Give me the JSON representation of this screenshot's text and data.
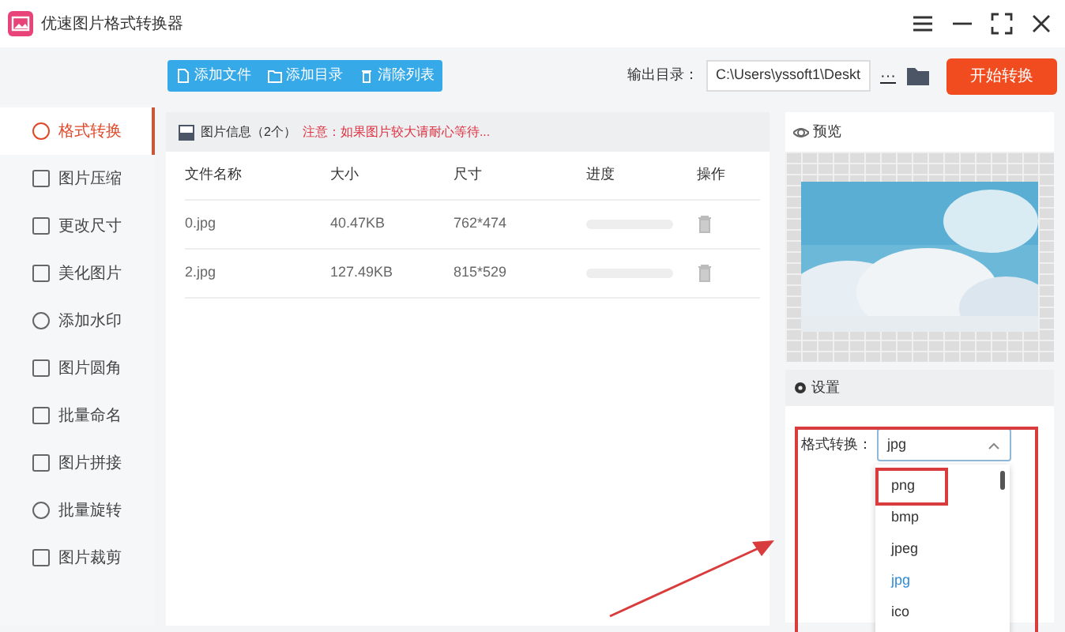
{
  "window": {
    "title": "优速图片格式转换器"
  },
  "toolbar": {
    "buttons": [
      {
        "label": "添加文件"
      },
      {
        "label": "添加目录"
      },
      {
        "label": "清除列表"
      }
    ],
    "output_label": "输出目录：",
    "output_path": "C:\\Users\\yssoft1\\Deskt",
    "more": "···",
    "start_button": "开始转换"
  },
  "sidebar": {
    "items": [
      {
        "label": "格式转换",
        "selected": true
      },
      {
        "label": "图片压缩",
        "selected": false
      },
      {
        "label": "更改尺寸",
        "selected": false
      },
      {
        "label": "美化图片",
        "selected": false
      },
      {
        "label": "添加水印",
        "selected": false
      },
      {
        "label": "图片圆角",
        "selected": false
      },
      {
        "label": "批量命名",
        "selected": false
      },
      {
        "label": "图片拼接",
        "selected": false
      },
      {
        "label": "批量旋转",
        "selected": false
      },
      {
        "label": "图片裁剪",
        "selected": false
      }
    ]
  },
  "file_panel": {
    "title": "图片信息（2个）",
    "note": "注意：如果图片较大请耐心等待...",
    "table": {
      "columns": [
        "文件名称",
        "大小",
        "尺寸",
        "进度",
        "操作"
      ],
      "rows": [
        {
          "name": "0.jpg",
          "size": "40.47KB",
          "dimensions": "762*474",
          "level": 0
        },
        {
          "name": "2.jpg",
          "size": "127.49KB",
          "dimensions": "815*529",
          "level": 0
        }
      ]
    }
  },
  "preview": {
    "title": "预览"
  },
  "settings": {
    "title": "设置",
    "format_label": "格式转换：",
    "format_value": "jpg",
    "options": [
      {
        "label": "png",
        "selected": false,
        "highlighted": true
      },
      {
        "label": "bmp",
        "selected": false,
        "highlighted": false
      },
      {
        "label": "jpeg",
        "selected": false,
        "highlighted": false
      },
      {
        "label": "jpg",
        "selected": true,
        "highlighted": false
      },
      {
        "label": "ico",
        "selected": false,
        "highlighted": false
      }
    ]
  }
}
